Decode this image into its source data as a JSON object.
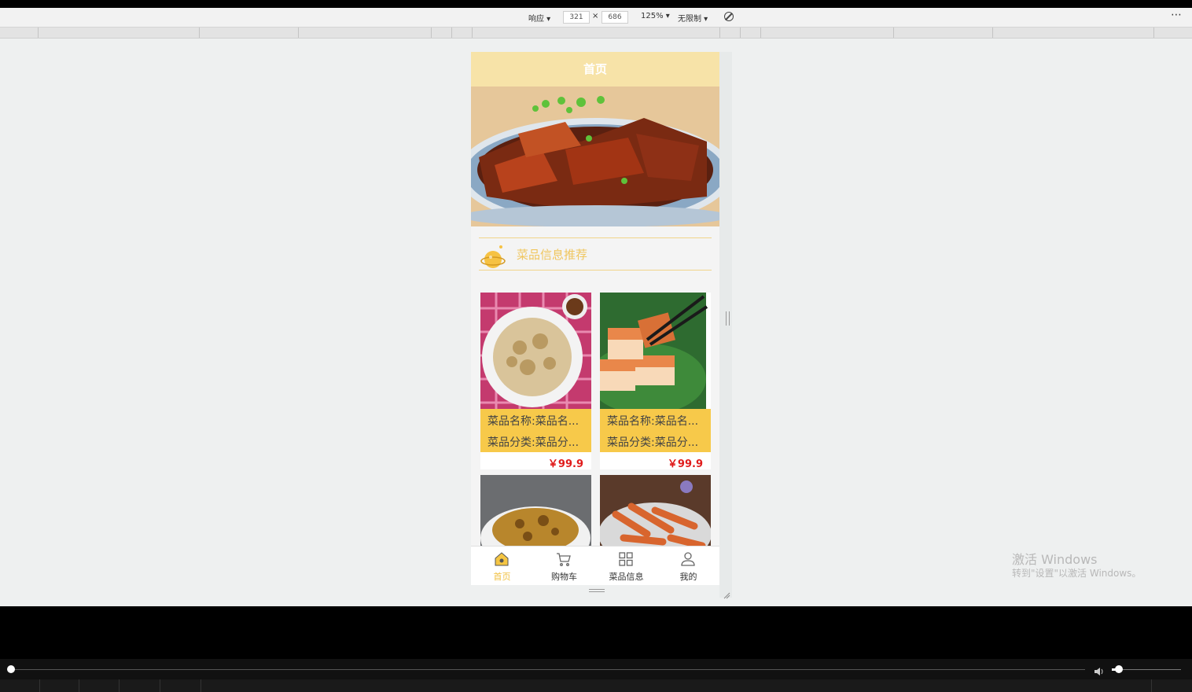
{
  "devtools": {
    "mode_label": "响应 ▾",
    "width_value": "321",
    "times": "×",
    "height_value": "686",
    "zoom_label": "125% ▾",
    "throttle_label": "无限制 ▾",
    "rotate_icon": "no-rotate-icon",
    "more": "⋯"
  },
  "app": {
    "header_title": "首页",
    "section_title": "菜品信息推荐",
    "cards": [
      {
        "name": "菜品名称:菜品名...",
        "category": "菜品分类:菜品分...",
        "price": "￥99.9"
      },
      {
        "name": "菜品名称:菜品名...",
        "category": "菜品分类:菜品分...",
        "price": "￥99.9"
      }
    ],
    "tabs": [
      {
        "label": "首页",
        "icon": "home-icon",
        "active": true
      },
      {
        "label": "购物车",
        "icon": "cart-icon",
        "active": false
      },
      {
        "label": "菜品信息",
        "icon": "grid-icon",
        "active": false
      },
      {
        "label": "我的",
        "icon": "user-icon",
        "active": false
      }
    ]
  },
  "watermark": {
    "line1": "激活 Windows",
    "line2": "转到\"设置\"以激活 Windows。"
  },
  "player": {
    "progress": 0.0,
    "volume": 0.1
  },
  "colors": {
    "header_bg": "#f7e3a8",
    "card_info_bg": "#f7c94a",
    "price": "#e01c1c",
    "active_tab": "#f0c040",
    "section_title": "#f0c65e"
  }
}
